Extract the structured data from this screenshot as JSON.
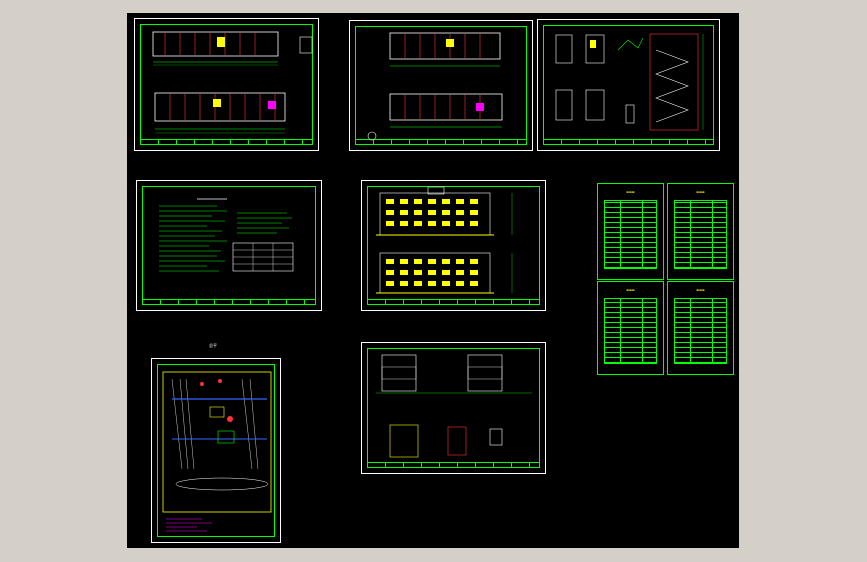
{
  "viewer": {
    "background_color": "#d4d0c8",
    "model_space_color": "#000000",
    "line_color": "#00ff00",
    "frame_color": "#ffffff"
  },
  "drawing": {
    "site_plan_label": "总平"
  }
}
